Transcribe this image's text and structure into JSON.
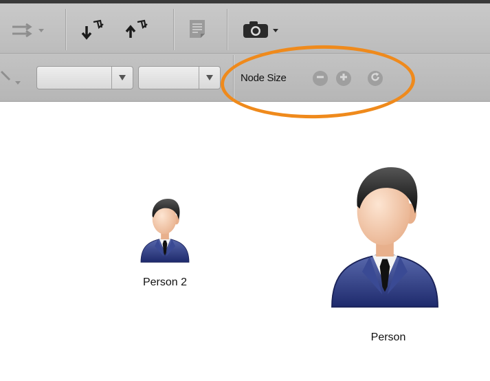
{
  "toolbar": {
    "layout_menu_icon": "layout-arrows-icon",
    "import_icon": "import-network-icon",
    "export_icon": "export-network-icon",
    "document_icon": "document-icon",
    "camera_icon": "camera-icon"
  },
  "style_toolbar": {
    "dropdown1_value": "",
    "dropdown2_value": "",
    "node_size_label": "Node Size",
    "decrease_icon": "minus-circle-icon",
    "increase_icon": "plus-circle-icon",
    "reset_icon": "refresh-icon"
  },
  "highlight": {
    "color": "#ef8a1c"
  },
  "canvas": {
    "nodes": [
      {
        "label": "Person 2",
        "icon": "person-icon"
      },
      {
        "label": "Person",
        "icon": "person-icon"
      }
    ]
  }
}
